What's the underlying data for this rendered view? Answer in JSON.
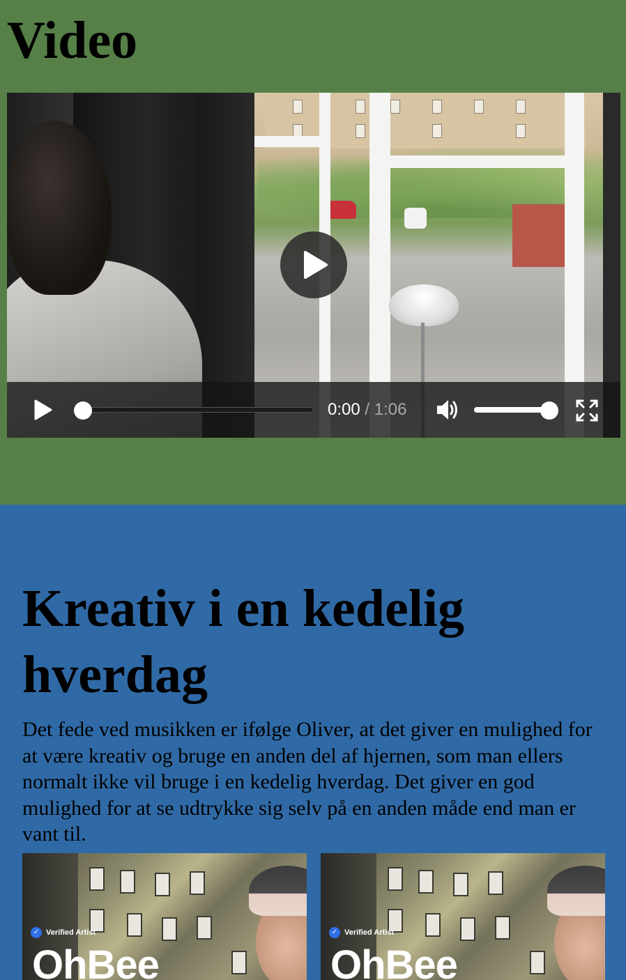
{
  "video_section": {
    "heading": "Video",
    "player": {
      "current_time": "0:00",
      "separator": "/",
      "duration": "1:06",
      "progress_fraction": 0.0,
      "volume_fraction": 1.0,
      "icons": {
        "big_play": "play-icon",
        "play": "play-icon",
        "volume": "volume-icon",
        "fullscreen": "fullscreen-icon"
      }
    }
  },
  "article": {
    "title": "Kreativ i en kedelig hverdag",
    "body": "Det fede ved musikken er ifølge Oliver, at det giver en mulighed for at være kreativ og bruge en anden del af hjernen, som man ellers normalt ikke vil bruge i en kedelig hverdag. Det giver en god mulighed for at se udtrykke sig selv på en anden måde end man er vant til.",
    "images": [
      {
        "verified_label": "Verified Artist",
        "artist_name": "OhBee"
      },
      {
        "verified_label": "Verified Artist",
        "artist_name": "OhBee"
      }
    ]
  },
  "colors": {
    "video_section_bg": "#578048",
    "article_bg": "#306aa6",
    "controls_bg": "#141414"
  }
}
